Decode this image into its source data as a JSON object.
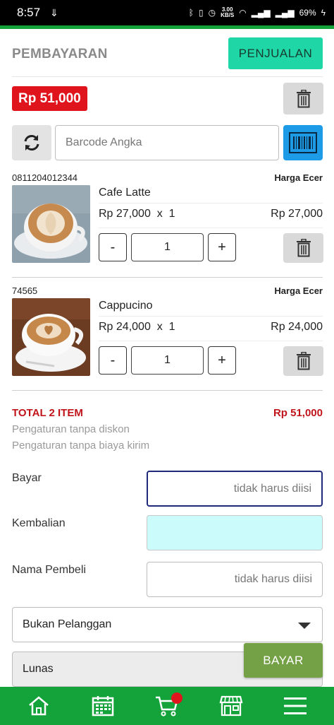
{
  "status_bar": {
    "time": "8:57",
    "speed_top": "3.00",
    "speed_bottom": "KB/S",
    "battery": "69%"
  },
  "header": {
    "title": "PEMBAYARAN",
    "sales_button": "PENJUALAN"
  },
  "cart_total_badge": "Rp 51,000",
  "search": {
    "placeholder": "Barcode Angka"
  },
  "items": [
    {
      "code": "0811204012344",
      "price_type": "Harga Ecer",
      "name": "Cafe Latte",
      "price_qty": "Rp 27,000  x  1",
      "subtotal": "Rp 27,000",
      "minus": "-",
      "qty": "1",
      "plus": "+"
    },
    {
      "code": "74565",
      "price_type": "Harga Ecer",
      "name": "Cappucino",
      "price_qty": "Rp 24,000  x  1",
      "subtotal": "Rp 24,000",
      "minus": "-",
      "qty": "1",
      "plus": "+"
    }
  ],
  "summary": {
    "total_items": "TOTAL 2 ITEM",
    "total_amount": "Rp 51,000",
    "discount_note": "Pengaturan tanpa diskon",
    "shipping_note": "Pengaturan tanpa biaya kirim"
  },
  "form": {
    "pay_label": "Bayar",
    "pay_placeholder": "tidak harus diisi",
    "change_label": "Kembalian",
    "buyer_label": "Nama Pembeli",
    "buyer_placeholder": "tidak harus diisi",
    "customer_select": "Bukan Pelanggan",
    "payment_status": "Lunas"
  },
  "pay_button": "BAYAR",
  "colors": {
    "brand_green": "#14a33a",
    "accent_teal": "#1fd7a6",
    "total_red": "#e0141c",
    "pay_green": "#74a046",
    "scan_blue": "#1e9be6"
  },
  "bottom_nav": [
    "home-icon",
    "calendar-icon",
    "cart-icon",
    "store-icon",
    "menu-icon"
  ]
}
